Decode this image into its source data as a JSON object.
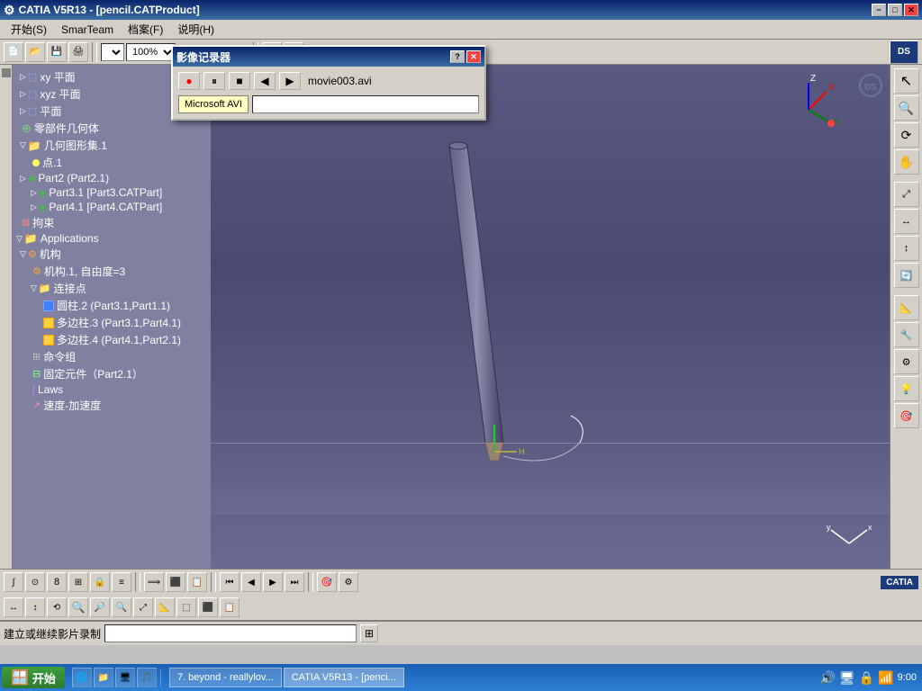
{
  "window": {
    "title": "CATIA V5R13 - [pencil.CATProduct]",
    "title_buttons": [
      "-",
      "□",
      "X"
    ]
  },
  "menu": {
    "items": [
      "开始(S)",
      "SmarTeam",
      "档案(F)",
      "说明(H)"
    ]
  },
  "toolbar": {
    "zoom_options": [
      "100%"
    ],
    "zoom_value": "100%",
    "select_value": ""
  },
  "dialog": {
    "title": "影像记录器",
    "controls": {
      "record": "●",
      "pause": "⏸",
      "stop": "■",
      "rewind": "◀",
      "play": "▶",
      "filename": "movie003.avi"
    },
    "format_label": "Microsoft AVI",
    "path_placeholder": ""
  },
  "tree": {
    "items": [
      {
        "indent": 1,
        "icon": "plane",
        "label": "xy 平面"
      },
      {
        "indent": 1,
        "icon": "plane",
        "label": "xyz 平面"
      },
      {
        "indent": 1,
        "icon": "plane",
        "label": "平面"
      },
      {
        "indent": 1,
        "icon": "gear",
        "label": "零部件几何体"
      },
      {
        "indent": 1,
        "icon": "folder",
        "label": "几何图形集.1"
      },
      {
        "indent": 2,
        "icon": "dot",
        "label": "点.1"
      },
      {
        "indent": 1,
        "icon": "part",
        "label": "Part2 (Part2.1)"
      },
      {
        "indent": 2,
        "icon": "part",
        "label": "Part3.1 [Part3.CATPart]"
      },
      {
        "indent": 2,
        "icon": "part",
        "label": "Part4.1 [Part4.CATPart]"
      },
      {
        "indent": 1,
        "icon": "constraint",
        "label": "拘束"
      },
      {
        "indent": 0,
        "icon": "folder",
        "label": "Applications"
      },
      {
        "indent": 1,
        "icon": "mechanism",
        "label": "机构"
      },
      {
        "indent": 2,
        "icon": "mechanism-item",
        "label": "机构.1, 自由度=3"
      },
      {
        "indent": 2,
        "icon": "joint-folder",
        "label": "连接点"
      },
      {
        "indent": 3,
        "icon": "joint",
        "label": "圆柱.2 (Part3.1,Part1.1)"
      },
      {
        "indent": 3,
        "icon": "joint",
        "label": "多边柱.3 (Part3.1,Part4.1)"
      },
      {
        "indent": 3,
        "icon": "joint",
        "label": "多边柱.4 (Part4.1,Part2.1)"
      },
      {
        "indent": 2,
        "icon": "command",
        "label": "命令组"
      },
      {
        "indent": 2,
        "icon": "fixed",
        "label": "固定元件（Part2.1）"
      },
      {
        "indent": 2,
        "icon": "laws",
        "label": "Laws"
      },
      {
        "indent": 2,
        "icon": "speed",
        "label": "速度-加速度"
      }
    ]
  },
  "right_toolbar": {
    "buttons": [
      "↖",
      "🔍",
      "↔",
      "↕",
      "⟳",
      "↙",
      "⤢",
      "🔄",
      "📐",
      "🔧",
      "⚙",
      "💡",
      "🎯"
    ]
  },
  "bottom_toolbar1": {
    "buttons": [
      "∫",
      "⊙",
      "8",
      "⊞",
      "🔒",
      "≡",
      "⟹",
      "⟸",
      "⬚",
      "⬛",
      "⟳",
      "↻",
      "↷",
      "📋",
      "🎬",
      "▶",
      "⏹",
      "⏮",
      "⏭",
      "🎯",
      "⚙"
    ]
  },
  "bottom_toolbar2": {
    "buttons": [
      "↔",
      "↕",
      "⟲",
      "🔍",
      "🔍+",
      "🔍-",
      "⤢",
      "📐",
      "⬚",
      "⬛",
      "📋"
    ]
  },
  "status": {
    "text": "建立或继续影片录制",
    "path": ""
  },
  "taskbar": {
    "start_label": "开始",
    "apps": [
      "7. beyond - reallylov...",
      "CATIA V5R13 - [penci..."
    ],
    "time": "9:00"
  },
  "viewport": {
    "compass_axes": [
      "X",
      "Y",
      "Z"
    ],
    "dassault_logo": "DS"
  }
}
